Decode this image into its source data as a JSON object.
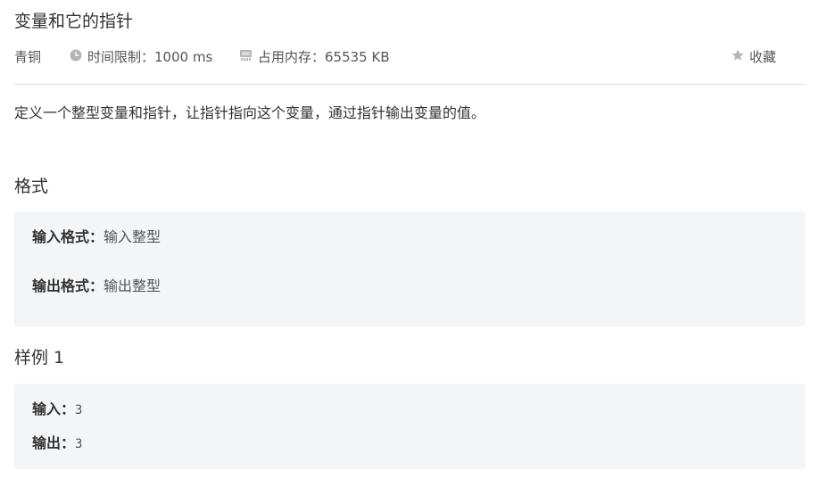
{
  "problem": {
    "title": "变量和它的指针",
    "level": "青铜",
    "time_limit": "时间限制：1000 ms",
    "memory_limit": "占用内存：65535 KB",
    "favorite": "收藏",
    "description": "定义一个整型变量和指针，让指针指向这个变量，通过指针输出变量的值。"
  },
  "format": {
    "heading": "格式",
    "input_label": "输入格式：",
    "input_value": "输入整型",
    "output_label": "输出格式：",
    "output_value": "输出整型"
  },
  "sample": {
    "heading": "样例 1",
    "input_label": "输入：",
    "input_value": "3",
    "output_label": "输出：",
    "output_value": "3"
  },
  "icons": {
    "time": "clock-icon",
    "memory": "memory-icon",
    "favorite": "star-icon"
  },
  "colors": {
    "box_bg": "#f4f5f7",
    "icon_gray": "#b5b5b5"
  }
}
